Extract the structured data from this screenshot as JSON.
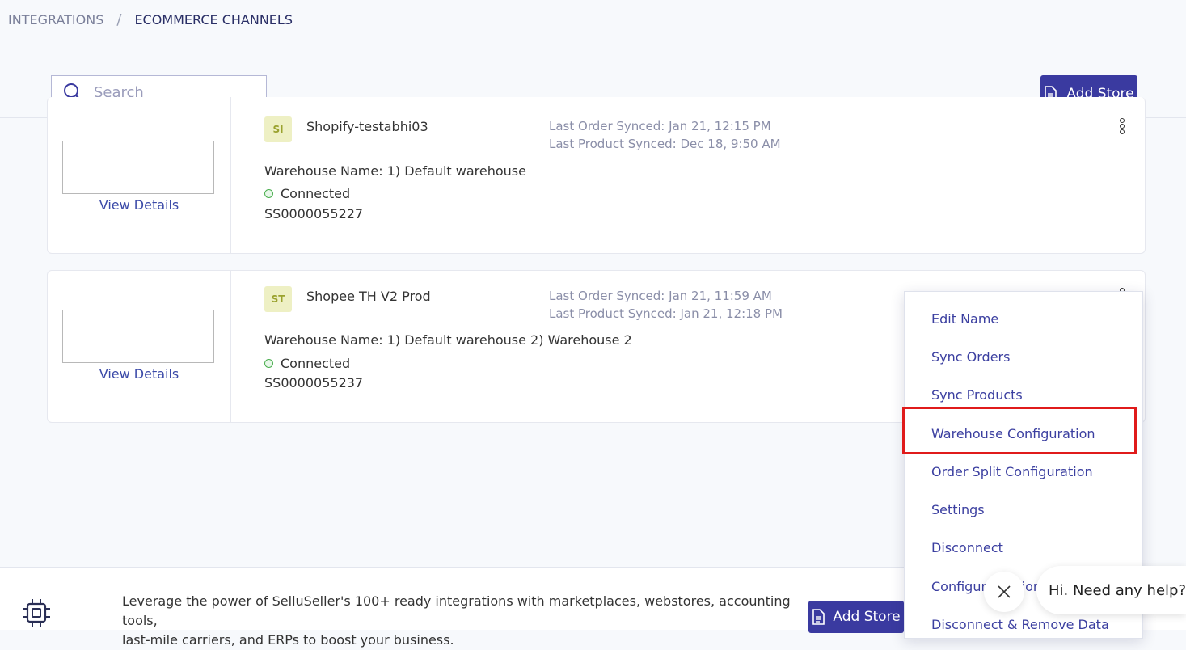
{
  "breadcrumb": {
    "parent": "INTEGRATIONS",
    "separator": "/",
    "current": "ECOMMERCE CHANNELS"
  },
  "search": {
    "placeholder": "Search",
    "value": ""
  },
  "header": {
    "add_store_label": "Add Store"
  },
  "stores": [
    {
      "badge": "SI",
      "name": "Shopify-testabhi03",
      "last_order_label": "Last Order Synced:",
      "last_order_value": "Jan 21, 12:15 PM",
      "last_product_label": "Last Product Synced:",
      "last_product_value": "Dec 18, 9:50 AM",
      "warehouse": "Warehouse Name: 1) Default warehouse",
      "status": "Connected",
      "code": "SS0000055227",
      "view_details": "View Details"
    },
    {
      "badge": "ST",
      "name": "Shopee TH V2 Prod",
      "last_order_label": "Last Order Synced:",
      "last_order_value": "Jan 21, 11:59 AM",
      "last_product_label": "Last Product Synced:",
      "last_product_value": "Jan 21, 12:18 PM",
      "warehouse": "Warehouse Name: 1) Default warehouse 2) Warehouse 2",
      "status": "Connected",
      "code": "SS0000055237",
      "view_details": "View Details"
    }
  ],
  "menu": {
    "items": [
      "Edit Name",
      "Sync Orders",
      "Sync Products",
      "Warehouse Configuration",
      "Order Split Configuration",
      "Settings",
      "Disconnect",
      "Configure Option",
      "Disconnect & Remove Data"
    ],
    "highlighted": "Warehouse Configuration"
  },
  "footer": {
    "promo_line1": "Leverage the power of SelluSeller's 100+ ready integrations with marketplaces, webstores, accounting tools,",
    "promo_line2": "last-mile carriers, and ERPs to boost your business.",
    "add_store_label": "Add Store"
  },
  "chat": {
    "help_text": "Hi. Need any help?"
  },
  "colors": {
    "accent": "#3a3aa0",
    "link": "#3b3fa0",
    "highlight": "#e01b1b",
    "connected": "#4caf50"
  }
}
